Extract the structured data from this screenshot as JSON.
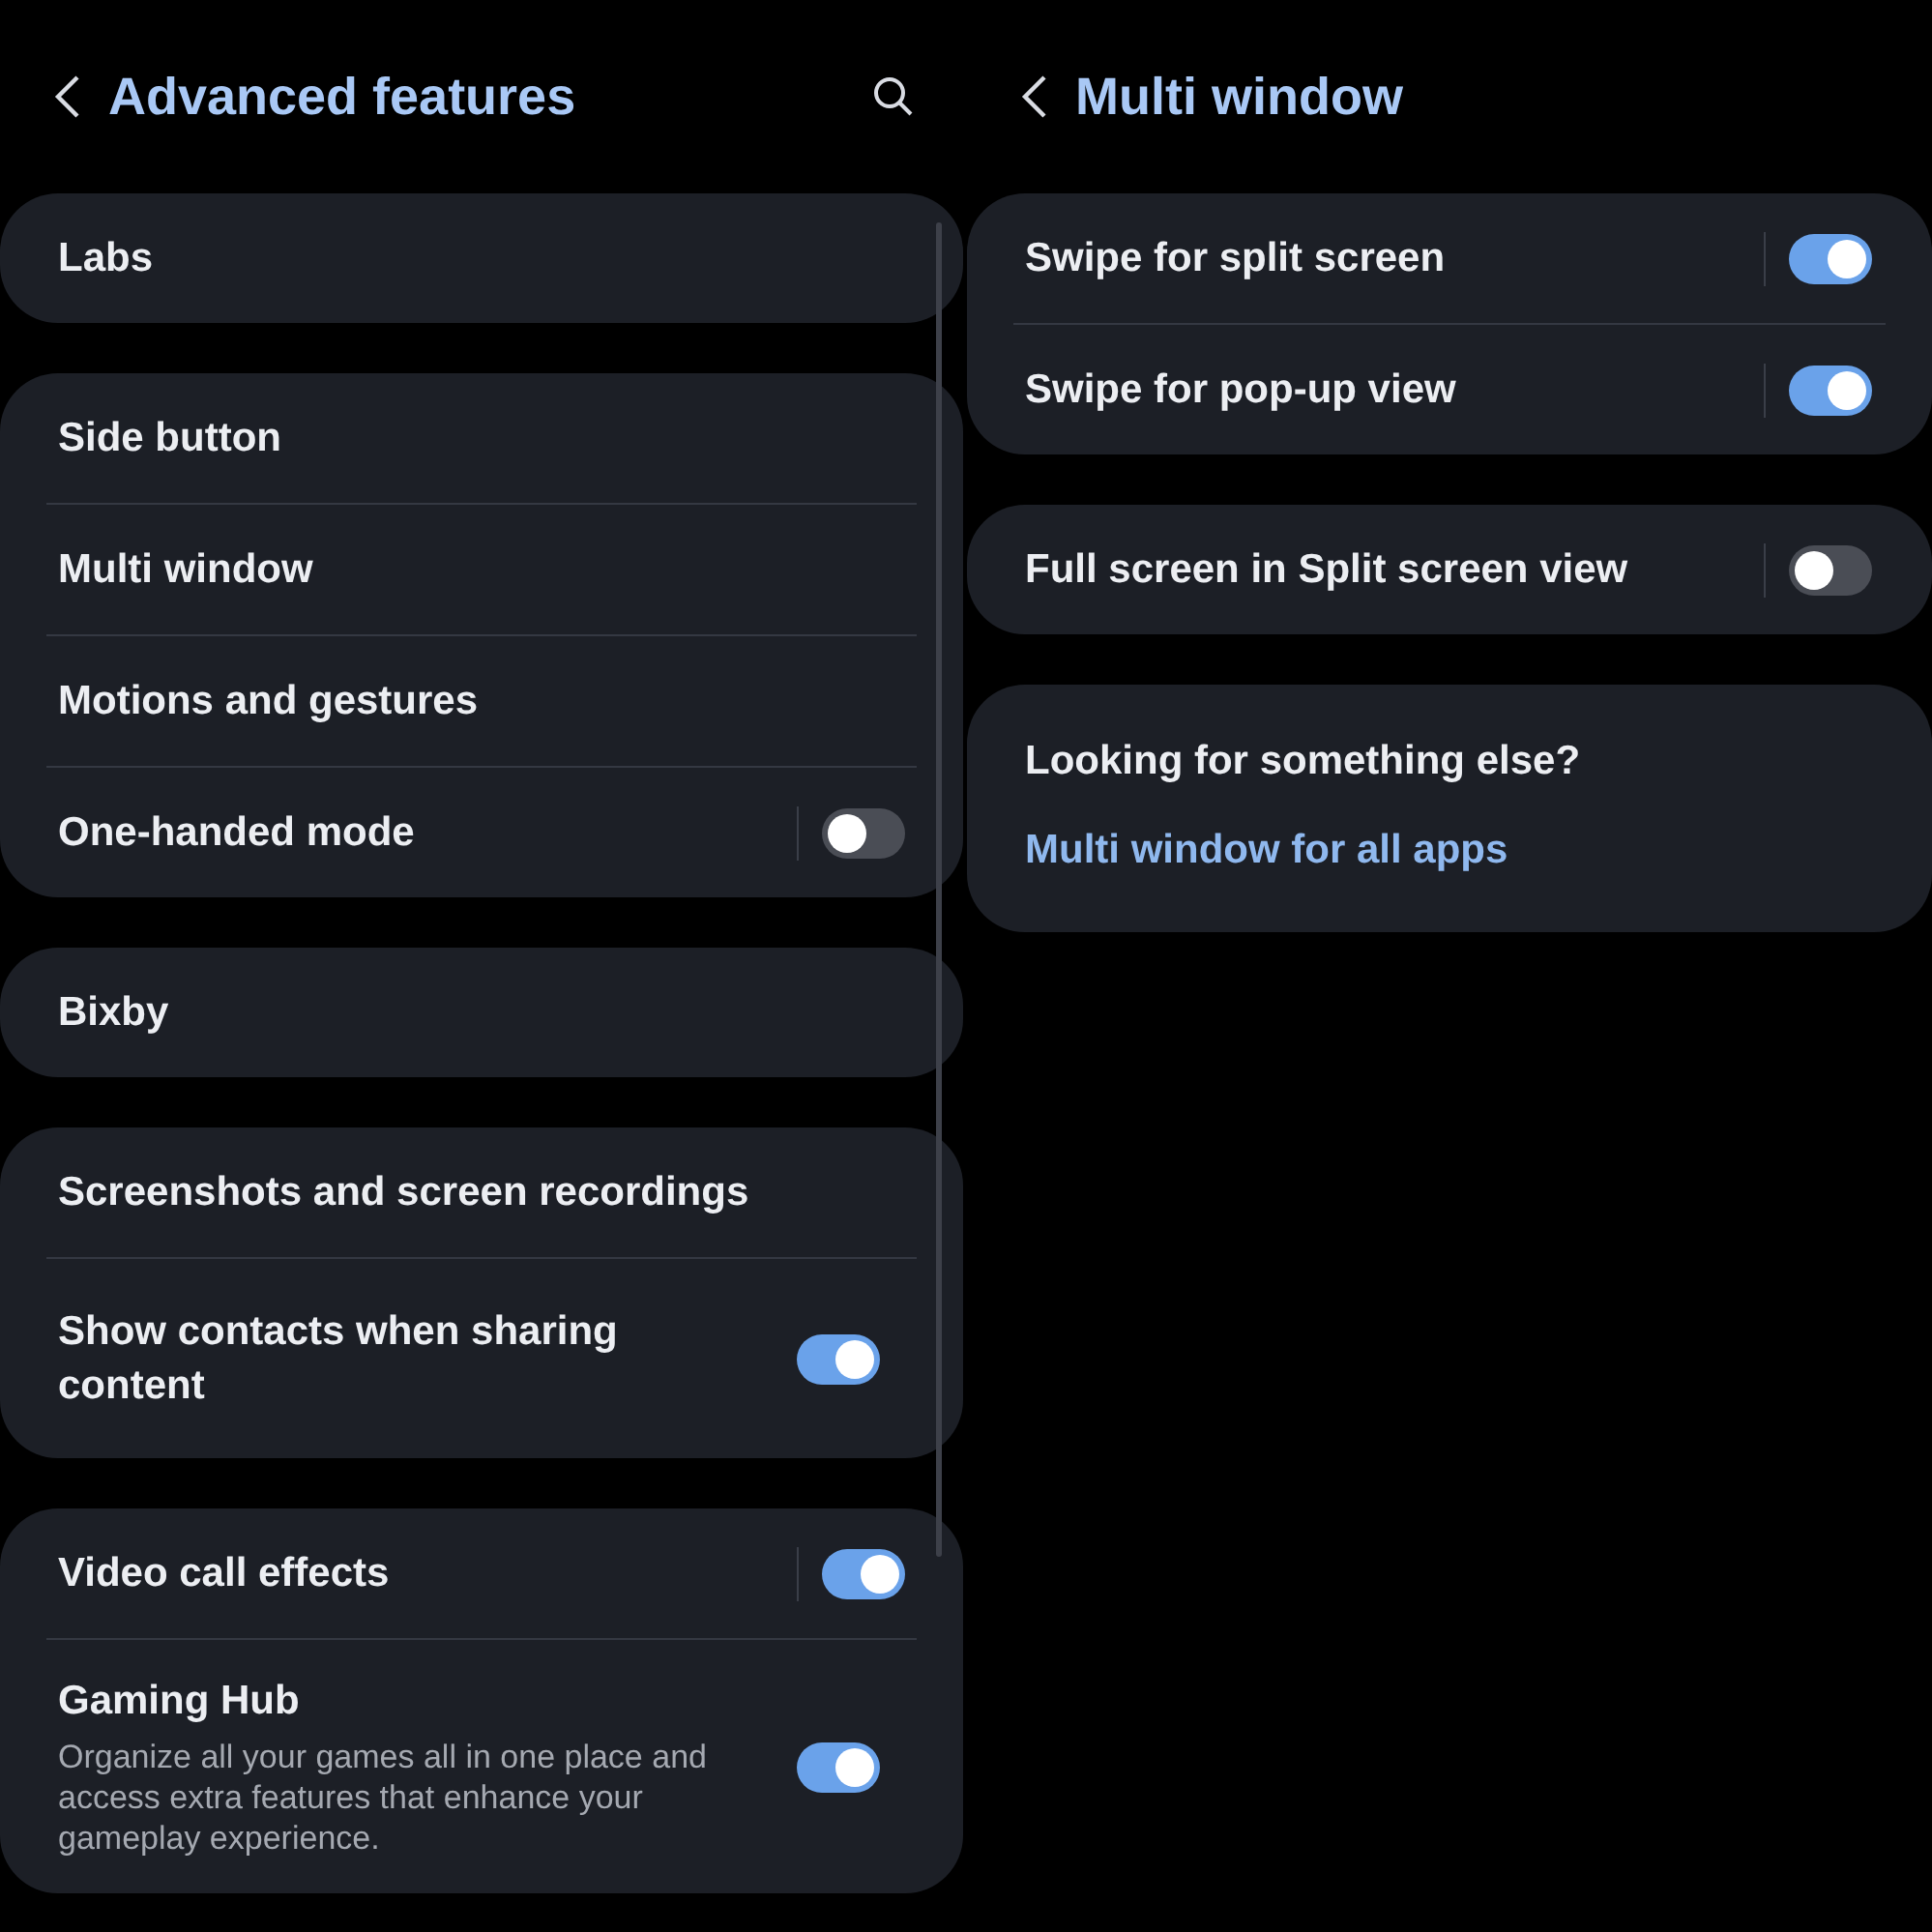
{
  "panels": [
    {
      "title": "Advanced features",
      "back": true,
      "search": true,
      "scrollbar": true,
      "groups": [
        {
          "items": [
            {
              "kind": "nav",
              "label": "Labs"
            }
          ]
        },
        {
          "items": [
            {
              "kind": "nav",
              "label": "Side button"
            },
            {
              "kind": "nav",
              "label": "Multi window"
            },
            {
              "kind": "nav",
              "label": "Motions and gestures"
            },
            {
              "kind": "switch",
              "label": "One-handed mode",
              "on": false,
              "separator": true
            }
          ]
        },
        {
          "items": [
            {
              "kind": "nav",
              "label": "Bixby"
            }
          ]
        },
        {
          "items": [
            {
              "kind": "nav",
              "label": "Screenshots and screen recordings"
            },
            {
              "kind": "switch",
              "label": "Show contacts when sharing content",
              "on": true,
              "separator": false
            }
          ]
        },
        {
          "items": [
            {
              "kind": "switch",
              "label": "Video call effects",
              "on": true,
              "separator": true
            },
            {
              "kind": "switch",
              "label": "Gaming Hub",
              "description": "Organize all your games all in one place and access extra features that enhance your gameplay experience.",
              "on": true,
              "separator": false
            }
          ]
        }
      ]
    },
    {
      "title": "Multi window",
      "back": true,
      "search": false,
      "scrollbar": false,
      "groups": [
        {
          "items": [
            {
              "kind": "switch",
              "label": "Swipe for split screen",
              "on": true,
              "separator": true
            },
            {
              "kind": "switch",
              "label": "Swipe for pop-up view",
              "on": true,
              "separator": true
            }
          ]
        },
        {
          "items": [
            {
              "kind": "switch",
              "label": "Full screen in Split screen view",
              "on": false,
              "separator": true
            }
          ]
        },
        {
          "items": [
            {
              "kind": "suggest",
              "heading": "Looking for something else?",
              "link": "Multi window for all apps"
            }
          ]
        }
      ]
    }
  ]
}
